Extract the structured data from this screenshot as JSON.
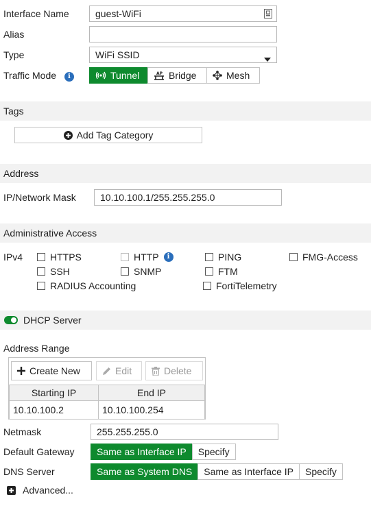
{
  "interface": {
    "name_label": "Interface Name",
    "name_value": "guest-WiFi",
    "alias_label": "Alias",
    "alias_value": "",
    "type_label": "Type",
    "type_value": "WiFi SSID",
    "traffic_mode_label": "Traffic Mode",
    "traffic_modes": [
      {
        "label": "Tunnel",
        "icon": "tunnel-icon",
        "active": true
      },
      {
        "label": "Bridge",
        "icon": "bridge-icon",
        "active": false
      },
      {
        "label": "Mesh",
        "icon": "mesh-icon",
        "active": false
      }
    ]
  },
  "tags": {
    "title": "Tags",
    "add_button": "Add Tag Category"
  },
  "address": {
    "title": "Address",
    "ip_label": "IP/Network Mask",
    "ip_value": "10.10.100.1/255.255.255.0"
  },
  "admin_access": {
    "title": "Administrative Access",
    "ipv4_label": "IPv4",
    "options": [
      {
        "label": "HTTPS",
        "checked": false,
        "disabled": false
      },
      {
        "label": "HTTP",
        "checked": false,
        "disabled": true
      },
      {
        "label": "PING",
        "checked": false,
        "disabled": false
      },
      {
        "label": "FMG-Access",
        "checked": false,
        "disabled": false
      },
      {
        "label": "SSH",
        "checked": false,
        "disabled": false
      },
      {
        "label": "SNMP",
        "checked": false,
        "disabled": false
      },
      {
        "label": "FTM",
        "checked": false,
        "disabled": false
      },
      {
        "label": "RADIUS Accounting",
        "checked": false,
        "disabled": false
      },
      {
        "label": "FortiTelemetry",
        "checked": false,
        "disabled": false
      }
    ]
  },
  "dhcp": {
    "title": "DHCP Server",
    "enabled": true,
    "range_label": "Address Range",
    "toolbar": {
      "create": "Create New",
      "edit": "Edit",
      "delete": "Delete"
    },
    "columns": [
      "Starting IP",
      "End IP"
    ],
    "rows": [
      [
        "10.10.100.2",
        "10.10.100.254"
      ]
    ],
    "netmask_label": "Netmask",
    "netmask_value": "255.255.255.0",
    "gateway_label": "Default Gateway",
    "gateway_options": [
      "Same as Interface IP",
      "Specify"
    ],
    "gateway_selected": "Same as Interface IP",
    "dns_label": "DNS Server",
    "dns_options": [
      "Same as System DNS",
      "Same as Interface IP",
      "Specify"
    ],
    "dns_selected": "Same as System DNS",
    "advanced_label": "Advanced..."
  },
  "colors": {
    "accent": "#0e8a2e",
    "info": "#2a6ebb"
  }
}
